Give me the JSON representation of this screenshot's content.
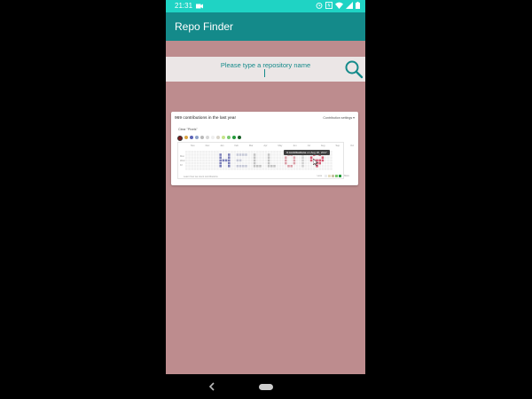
{
  "status_bar": {
    "time": "21:31",
    "icons": [
      "camera-icon",
      "alarm-icon",
      "nfc-icon",
      "wifi-icon",
      "signal-icon",
      "battery-icon"
    ]
  },
  "app_bar": {
    "title": "Repo Finder"
  },
  "search": {
    "placeholder": "Please type a repository name",
    "icon": "search-icon"
  },
  "preview": {
    "heading": "969 contributions in the last year",
    "settings": "Contribution settings ▾",
    "clear_label": "Clear \"Pixels\"",
    "months": [
      "Nov",
      "Dec",
      "Jan",
      "Feb",
      "Mar",
      "Apr",
      "May",
      "Jun",
      "Jul",
      "Aug",
      "Sep",
      "Oct"
    ],
    "days": [
      "Mon",
      "Wed",
      "Fri"
    ],
    "tooltip_bold": "3 contributions",
    "tooltip_rest": " on Aug 20, 2017",
    "learn_link": "Learn how we count contributions",
    "legend_less": "Less",
    "legend_more": "More"
  },
  "colors": {
    "status_bar": "#1fd3c4",
    "app_bar": "#148a8a",
    "background": "#bd8c8e",
    "search_panel": "#ebe6e6",
    "accent": "#148a8a"
  }
}
